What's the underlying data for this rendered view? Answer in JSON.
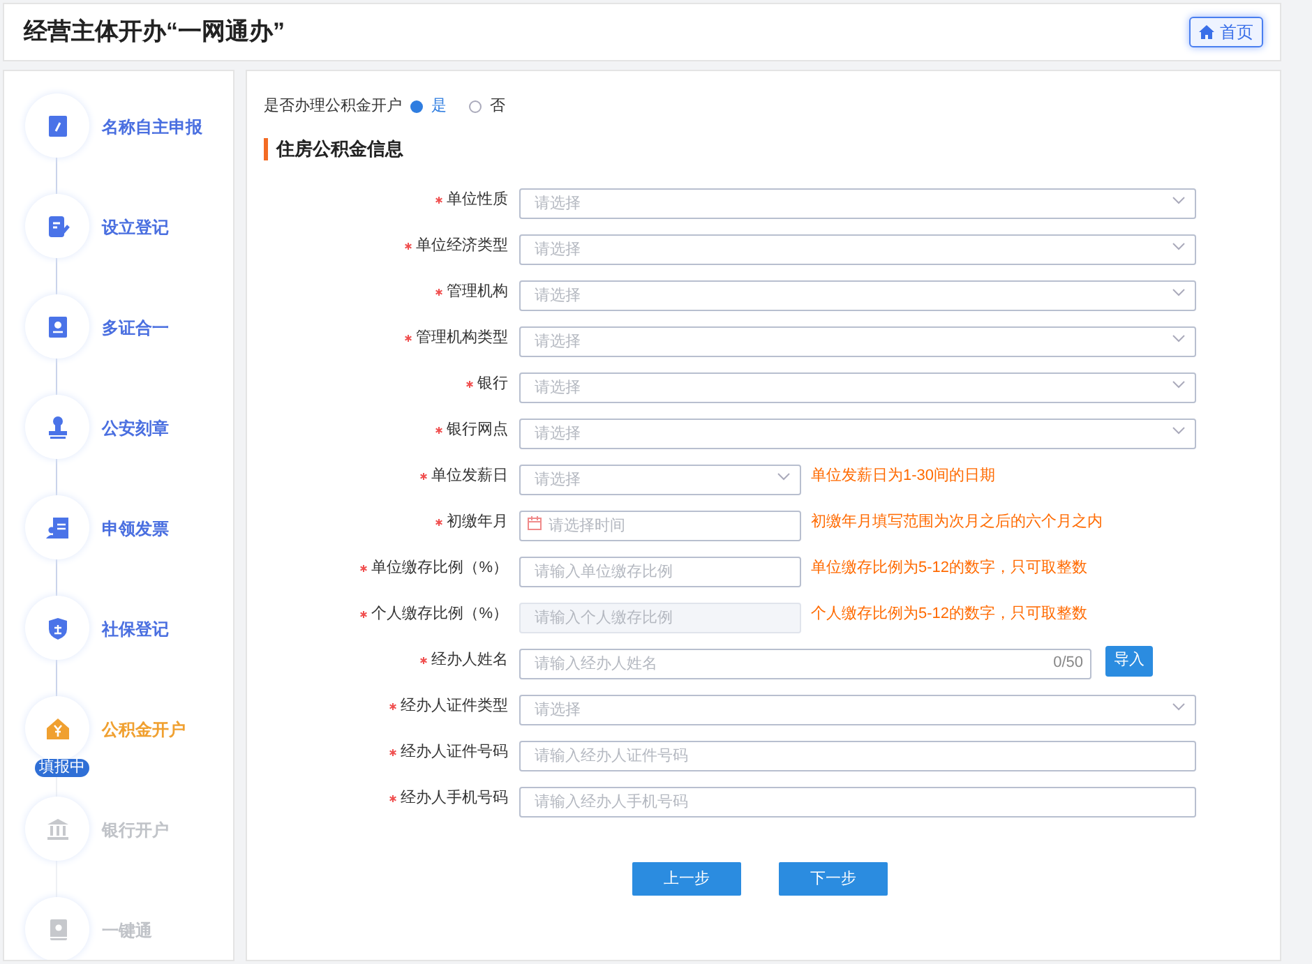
{
  "header": {
    "title": "经营主体开办“一网通办”",
    "home_button": "首页"
  },
  "steps": [
    {
      "label": "名称自主申报",
      "reached": true,
      "current": false
    },
    {
      "label": "设立登记",
      "reached": true,
      "current": false
    },
    {
      "label": "多证合一",
      "reached": true,
      "current": false
    },
    {
      "label": "公安刻章",
      "reached": true,
      "current": false
    },
    {
      "label": "申领发票",
      "reached": true,
      "current": false
    },
    {
      "label": "社保登记",
      "reached": true,
      "current": false
    },
    {
      "label": "公积金开户",
      "reached": true,
      "current": true,
      "badge": "填报中"
    },
    {
      "label": "银行开户",
      "reached": false,
      "current": false
    },
    {
      "label": "一键通",
      "reached": false,
      "current": false
    }
  ],
  "question": {
    "label": "是否办理公积金开户",
    "options": [
      {
        "label": "是",
        "selected": true
      },
      {
        "label": "否",
        "selected": false
      }
    ]
  },
  "section_title": "住房公积金信息",
  "fields": [
    {
      "label": "单位性质",
      "required": true,
      "kind": "select",
      "placeholder": "请选择"
    },
    {
      "label": "单位经济类型",
      "required": true,
      "kind": "select",
      "placeholder": "请选择"
    },
    {
      "label": "管理机构",
      "required": true,
      "kind": "select",
      "placeholder": "请选择"
    },
    {
      "label": "管理机构类型",
      "required": true,
      "kind": "select",
      "placeholder": "请选择"
    },
    {
      "label": "银行",
      "required": true,
      "kind": "select",
      "placeholder": "请选择"
    },
    {
      "label": "银行网点",
      "required": true,
      "kind": "select",
      "placeholder": "请选择"
    },
    {
      "label": "单位发薪日",
      "required": true,
      "kind": "select",
      "placeholder": "请选择",
      "hint": "单位发薪日为1-30间的日期"
    },
    {
      "label": "初缴年月",
      "required": true,
      "kind": "date",
      "placeholder": "请选择时间",
      "hint": "初缴年月填写范围为次月之后的六个月之内"
    },
    {
      "label": "单位缴存比例（%）",
      "required": true,
      "kind": "text",
      "placeholder": "请输入单位缴存比例",
      "hint": "单位缴存比例为5-12的数字，只可取整数",
      "disabled": false
    },
    {
      "label": "个人缴存比例（%）",
      "required": true,
      "kind": "text",
      "placeholder": "请输入个人缴存比例",
      "hint": "个人缴存比例为5-12的数字，只可取整数",
      "disabled": true
    },
    {
      "label": "经办人姓名",
      "required": true,
      "kind": "text",
      "placeholder": "请输入经办人姓名",
      "counter": "0/50",
      "button": "导入",
      "disabled": false
    },
    {
      "label": "经办人证件类型",
      "required": true,
      "kind": "select",
      "placeholder": "请选择"
    },
    {
      "label": "经办人证件号码",
      "required": true,
      "kind": "text",
      "placeholder": "请输入经办人证件号码",
      "disabled": false
    },
    {
      "label": "经办人手机号码",
      "required": true,
      "kind": "text",
      "placeholder": "请输入经办人手机号码",
      "disabled": false
    }
  ],
  "buttons": [
    "上一步",
    "下一步"
  ]
}
